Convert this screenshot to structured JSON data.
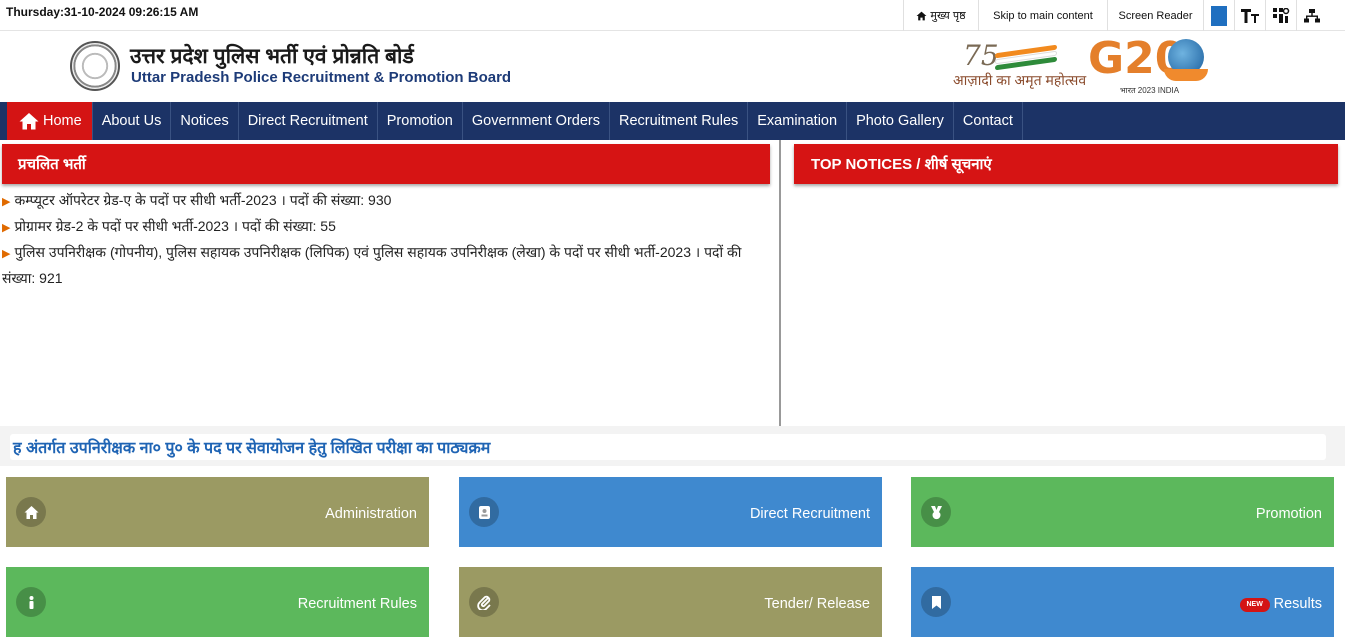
{
  "topbar": {
    "datetime": "Thursday:31-10-2024 09:26:15 AM",
    "home_label": "मुख्य पृष्ठ",
    "skip_label": "Skip to main content",
    "screen_reader_label": "Screen Reader",
    "theme_color": "#1f6fc0"
  },
  "header": {
    "title_hindi": "उत्तर प्रदेश पुलिस भर्ती एवं प्रोन्नति बोर्ड",
    "title_english": "Uttar Pradesh Police Recruitment & Promotion Board",
    "azadi_number": "75",
    "azadi_text": "आज़ादी का अमृत महोत्सव",
    "g20_text": "G20",
    "g20_caption": "भारत 2023 INDIA"
  },
  "nav": {
    "items": [
      {
        "label": "Home",
        "active": true
      },
      {
        "label": "About Us"
      },
      {
        "label": "Notices"
      },
      {
        "label": "Direct Recruitment"
      },
      {
        "label": "Promotion"
      },
      {
        "label": "Government Orders"
      },
      {
        "label": "Recruitment Rules"
      },
      {
        "label": "Examination"
      },
      {
        "label": "Photo Gallery"
      },
      {
        "label": "Contact"
      }
    ]
  },
  "vacancies": {
    "title": "प्रचलित भर्ती",
    "items": [
      "कम्प्यूटर ऑपरेटर ग्रेड-ए के पदों पर सीधी भर्ती-2023 । पदों की संख्या: 930",
      "प्रोग्रामर ग्रेड-2 के पदों पर सीधी भर्ती-2023 । पदों की संख्या: 55",
      "पुलिस उपनिरीक्षक (गोपनीय), पुलिस सहायक उपनिरीक्षक (लिपिक) एवं पुलिस सहायक उपनिरीक्षक (लेखा) के पदों पर सीधी भर्ती-2023 । पदों की संख्या: 921"
    ]
  },
  "notices": {
    "title": "TOP NOTICES / शीर्ष सूचनाएं"
  },
  "marquee": {
    "text": "ह अंतर्गत उपनिरीक्षक ना० पु० के पद पर सेवायोजन हेतु लिखित परीक्षा का पाठ्यक्रम"
  },
  "tiles": [
    {
      "label": "Administration",
      "icon": "home-icon",
      "color": "#9b9a63"
    },
    {
      "label": "Direct Recruitment",
      "icon": "id-card-icon",
      "color": "#3f89cf"
    },
    {
      "label": "Promotion",
      "icon": "medal-icon",
      "color": "#5cb85c"
    },
    {
      "label": "Recruitment Rules",
      "icon": "info-icon",
      "color": "#5cb85c"
    },
    {
      "label": "Tender/ Release",
      "icon": "paperclip-icon",
      "color": "#9b9a63"
    },
    {
      "label": "Results",
      "icon": "bookmark-icon",
      "color": "#3f89cf",
      "badge": "NEW"
    }
  ]
}
